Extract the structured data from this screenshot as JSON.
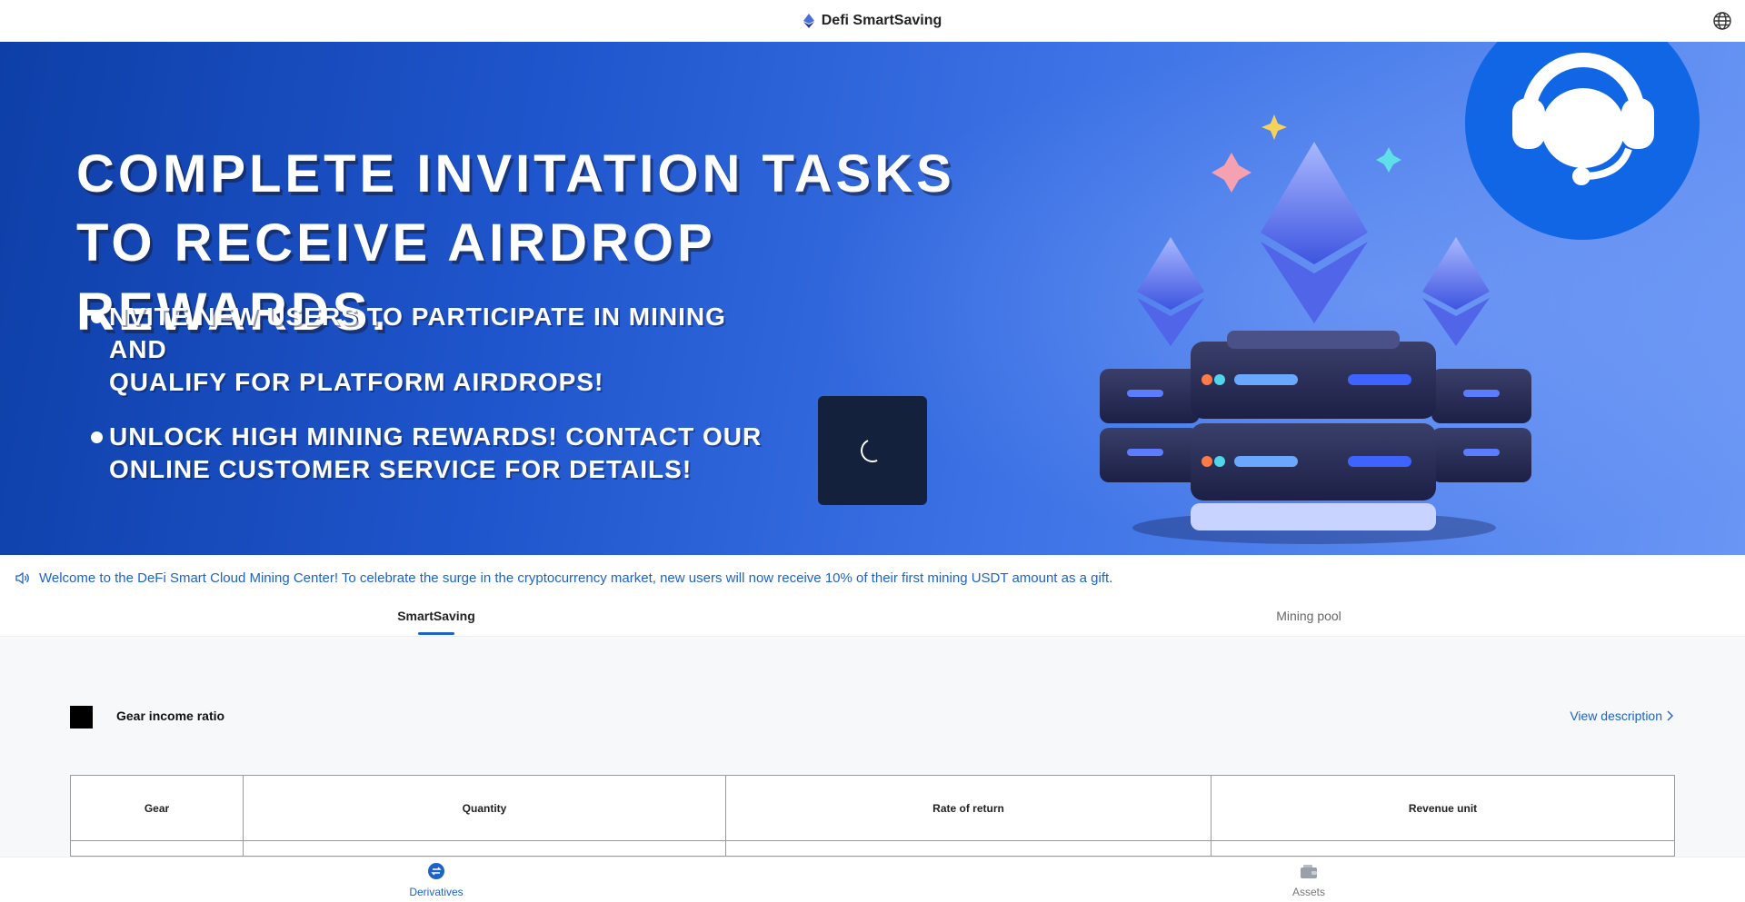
{
  "header": {
    "title": "Defi SmartSaving"
  },
  "banner": {
    "headline_line1": "COMPLETE INVITATION TASKS",
    "headline_line2": "TO RECEIVE AIRDROP REWARDS.",
    "bullets": [
      {
        "line1": "NVITE NEW USERS TO PARTICIPATE IN MINING AND",
        "line2": "QUALIFY FOR PLATFORM AIRDROPS!"
      },
      {
        "line1": "UNLOCK HIGH MINING REWARDS! CONTACT OUR",
        "line2": "ONLINE CUSTOMER SERVICE FOR DETAILS!"
      }
    ]
  },
  "notice": {
    "text": "Welcome to the DeFi Smart Cloud Mining Center! To celebrate the surge in the cryptocurrency market, new users will now receive 10% of their first mining USDT amount as a gift."
  },
  "tabs": [
    {
      "label": "SmartSaving",
      "active": true
    },
    {
      "label": "Mining pool",
      "active": false
    }
  ],
  "section": {
    "title": "Gear income ratio",
    "link_label": "View description"
  },
  "table": {
    "headers": [
      "Gear",
      "Quantity",
      "Rate of return",
      "Revenue unit"
    ]
  },
  "bottom_nav": [
    {
      "label": "Derivatives",
      "icon": "swap-icon",
      "active": true
    },
    {
      "label": "Assets",
      "icon": "wallet-icon",
      "active": false
    }
  ],
  "colors": {
    "accent": "#1e63c8",
    "banner_blue": "#1f55cc",
    "support_blue": "#1166e6",
    "loader_bg": "#14213d"
  }
}
